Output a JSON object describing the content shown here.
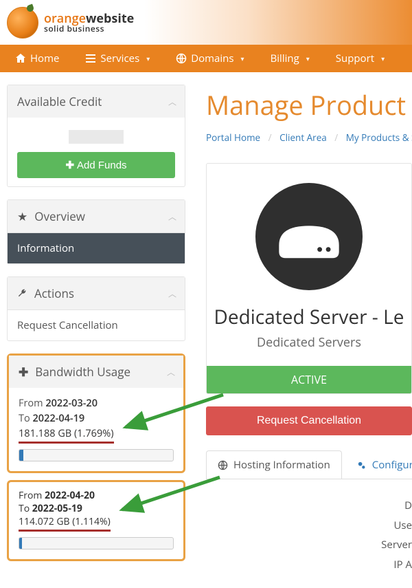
{
  "brand": {
    "word1": "orange",
    "word2": "website",
    "tagline": "solid business"
  },
  "nav": {
    "home": "Home",
    "services": "Services",
    "domains": "Domains",
    "billing": "Billing",
    "support": "Support"
  },
  "sidebar": {
    "credit": {
      "title": "Available Credit",
      "add_funds": "Add Funds"
    },
    "overview": {
      "title": "Overview",
      "item_information": "Information"
    },
    "actions": {
      "title": "Actions",
      "item_request_cancel": "Request Cancellation"
    },
    "bandwidth": {
      "title": "Bandwidth Usage",
      "from_label": "From",
      "to_label": "To",
      "period1": {
        "from": "2022-03-20",
        "to": "2022-04-19",
        "usage": "181.188 GB (1.769%)",
        "pct": 1.769
      },
      "period2": {
        "from": "2022-04-20",
        "to": "2022-05-19",
        "usage": "114.072 GB (1.114%)",
        "pct": 1.114
      }
    }
  },
  "page": {
    "title": "Manage Product",
    "crumbs": {
      "portal": "Portal Home",
      "client": "Client Area",
      "products": "My Products & Services"
    }
  },
  "product": {
    "name": "Dedicated Server - Le",
    "category": "Dedicated Servers",
    "status": "ACTIVE",
    "request_cancel": "Request Cancellation"
  },
  "tabs": {
    "hosting": "Hosting Information",
    "config": "Configurab"
  },
  "details": {
    "l1": "D",
    "l2": "Use",
    "l3": "Server",
    "l4": "IP A"
  }
}
